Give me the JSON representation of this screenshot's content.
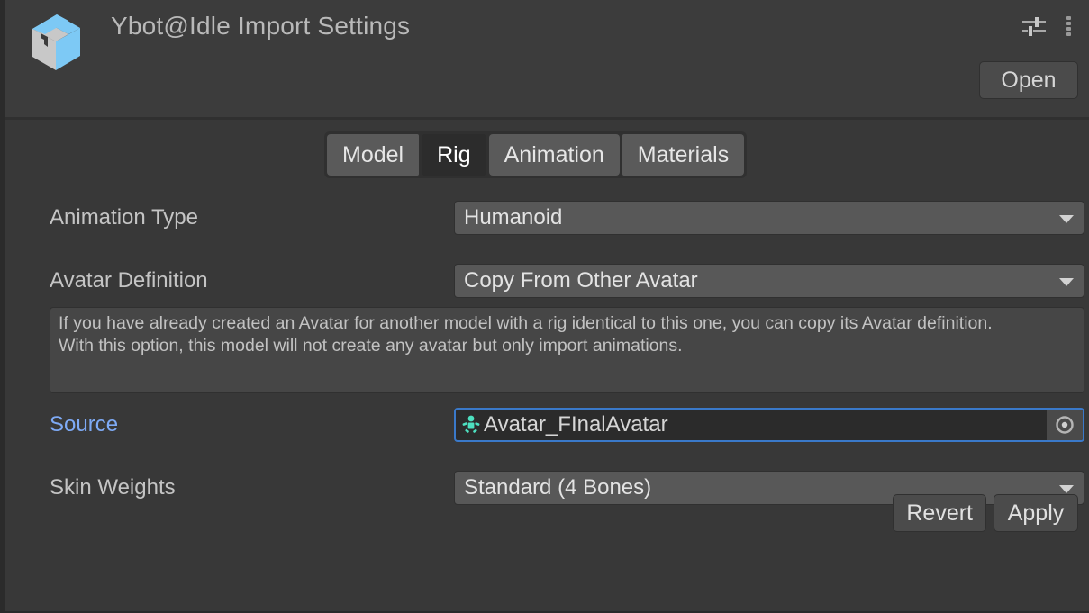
{
  "header": {
    "title": "Ybot@Idle Import Settings",
    "asset_icon": "model-prefab-box-icon",
    "preset_icon": "preset-sliders-icon",
    "menu_icon": "kebab-menu-icon",
    "open_label": "Open"
  },
  "tabs": [
    {
      "label": "Model",
      "selected": false
    },
    {
      "label": "Rig",
      "selected": true
    },
    {
      "label": "Animation",
      "selected": false
    },
    {
      "label": "Materials",
      "selected": false
    }
  ],
  "fields": {
    "animation_type": {
      "label": "Animation Type",
      "value": "Humanoid"
    },
    "avatar_definition": {
      "label": "Avatar Definition",
      "value": "Copy From Other Avatar"
    },
    "source": {
      "label": "Source",
      "value": "Avatar_FInalAvatar",
      "icon": "avatar-humanoid-icon",
      "picker_icon": "object-picker-icon"
    },
    "skin_weights": {
      "label": "Skin Weights",
      "value": "Standard (4 Bones)"
    }
  },
  "help_box": {
    "text": "If you have already created an Avatar for another model with a rig identical to this one, you can copy its Avatar definition.\nWith this option, this model will not create any avatar but only import animations."
  },
  "footer": {
    "revert_label": "Revert",
    "apply_label": "Apply"
  },
  "colors": {
    "background": "#383838",
    "header_background": "#3c3c3c",
    "accent_blue": "#3a79c9",
    "label_highlight": "#7eaaf5",
    "icon_blue": "#7dc9f5",
    "avatar_cyan": "#4de0c0",
    "tab_selected": "#2c2c2c",
    "tab_normal": "#5a5a5a"
  }
}
